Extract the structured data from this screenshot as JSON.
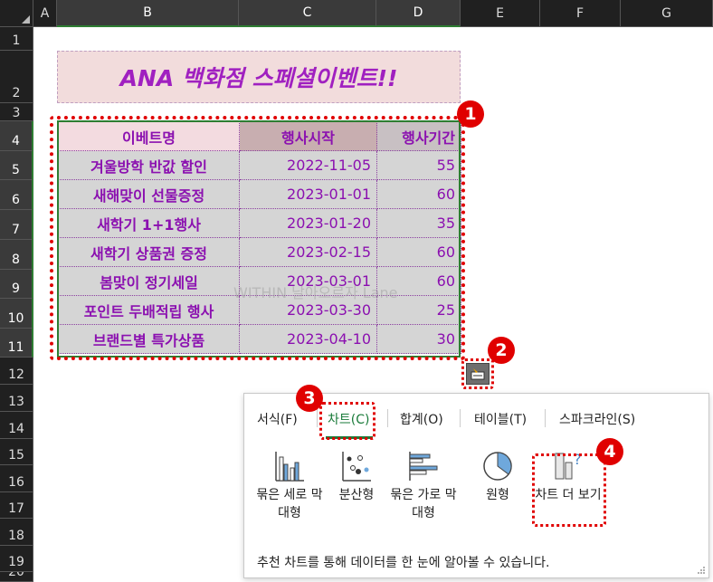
{
  "columns": [
    "A",
    "B",
    "C",
    "D",
    "E",
    "F",
    "G"
  ],
  "rows": [
    "1",
    "2",
    "3",
    "4",
    "5",
    "6",
    "7",
    "8",
    "9",
    "10",
    "11",
    "12",
    "13",
    "14",
    "15",
    "16",
    "17",
    "18",
    "19",
    "20"
  ],
  "title": "ANA 백화점 스페셜이벤트!!",
  "table": {
    "headers": [
      "이베트명",
      "행사시작",
      "행사기간"
    ],
    "rows": [
      {
        "name": "겨울방학 반값 할인",
        "start": "2022-11-05",
        "days": "55"
      },
      {
        "name": "새해맞이 선물증정",
        "start": "2023-01-01",
        "days": "60"
      },
      {
        "name": "새학기 1+1행사",
        "start": "2023-01-20",
        "days": "35"
      },
      {
        "name": "새학기 상품권 증정",
        "start": "2023-02-15",
        "days": "60"
      },
      {
        "name": "봄맞이 정기세일",
        "start": "2023-03-01",
        "days": "60"
      },
      {
        "name": "포인트 두배적립 행사",
        "start": "2023-03-30",
        "days": "25"
      },
      {
        "name": "브랜드별 특가상품",
        "start": "2023-04-10",
        "days": "30"
      }
    ]
  },
  "watermark": "WITHIN 날아오르자 Lane",
  "badges": [
    "1",
    "2",
    "3",
    "4"
  ],
  "quick_analysis": {
    "icon": "quick-analysis-icon",
    "tabs": [
      "서식(F)",
      "차트(C)",
      "합계(O)",
      "테이블(T)",
      "스파크라인(S)"
    ],
    "active_tab": "차트(C)",
    "charts": [
      {
        "label": "묶은 세로 막대형",
        "icon": "clustered-column-chart-icon"
      },
      {
        "label": "분산형",
        "icon": "scatter-chart-icon"
      },
      {
        "label": "묶은 가로 막대형",
        "icon": "clustered-bar-chart-icon"
      },
      {
        "label": "원형",
        "icon": "pie-chart-icon"
      },
      {
        "label": "차트 더 보기",
        "icon": "more-charts-icon"
      }
    ],
    "description": "추천 차트를 통해 데이터를 한 눈에 알아볼 수 있습니다."
  },
  "colors": {
    "accent_purple": "#8b10b0",
    "highlight_red": "#e00000",
    "selection_green": "#2e7d32"
  }
}
